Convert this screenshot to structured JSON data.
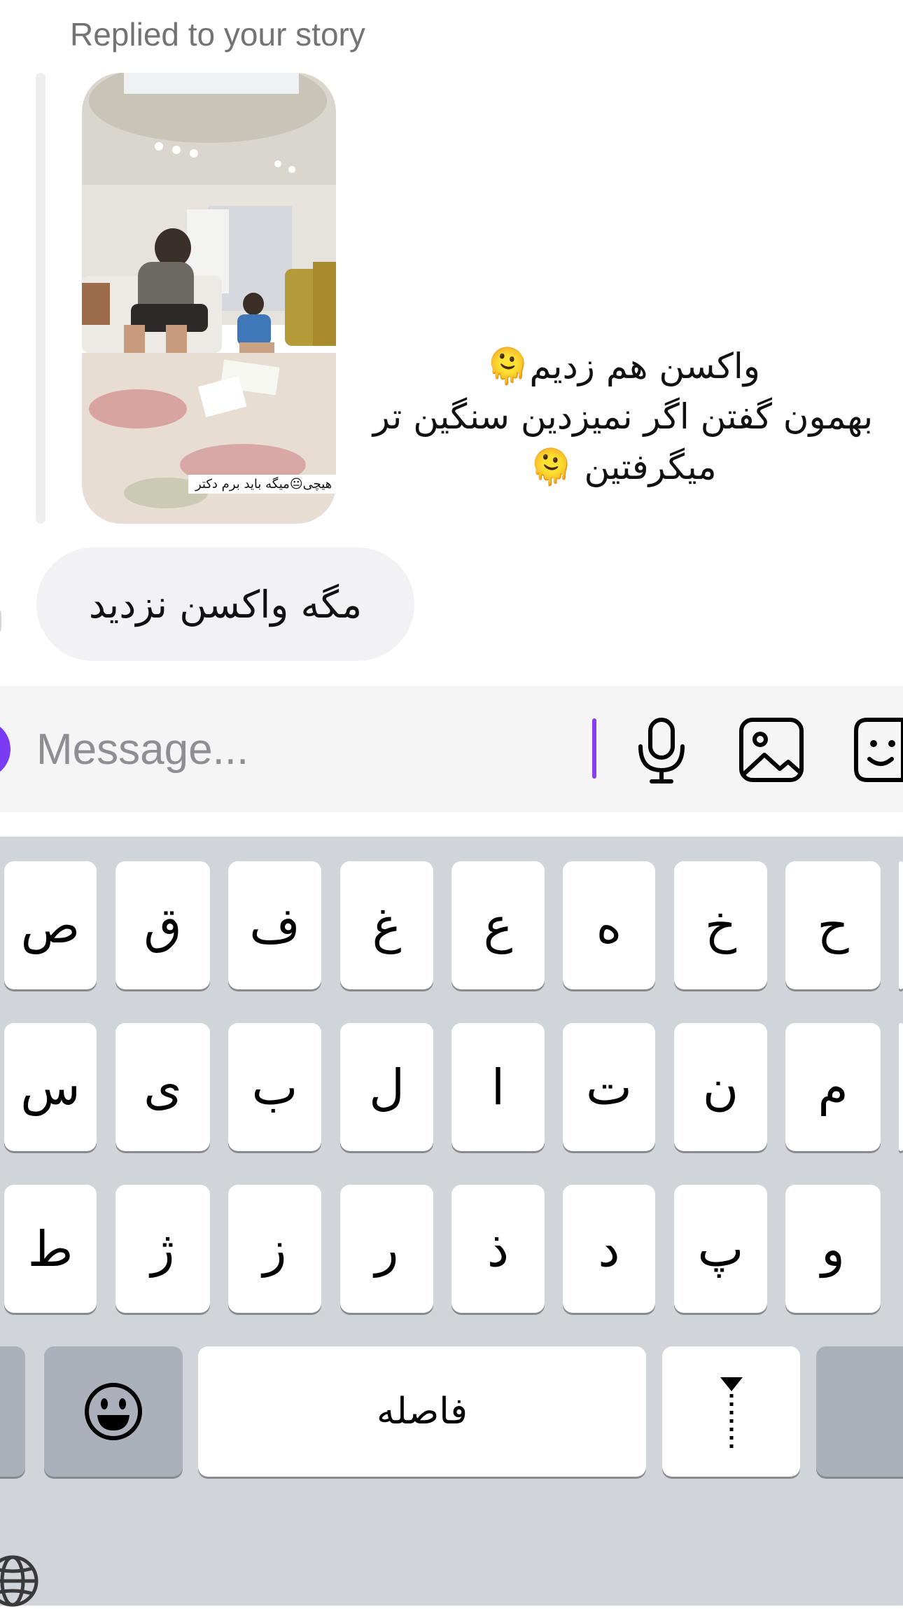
{
  "conversation": {
    "replied_label": "Replied to your story",
    "story_caption": "هیچی😐میگه باید برم دکتر",
    "story_text_lines": [
      "واکسن هم زدیم🫠",
      "بهمون گفتن اگر نمیزدین سنگین تر",
      "میگرفتین 🫠"
    ],
    "reply_message": "مگه واکسن نزدید"
  },
  "composer": {
    "placeholder": "Message...",
    "icons": [
      "microphone-icon",
      "image-icon",
      "sticker-icon"
    ],
    "accent_color": "#7a3cf2"
  },
  "keyboard": {
    "row1": [
      "ص",
      "ق",
      "ف",
      "غ",
      "ع",
      "ه",
      "خ",
      "ح"
    ],
    "row2": [
      "س",
      "ی",
      "ب",
      "ل",
      "ا",
      "ت",
      "ن",
      "م"
    ],
    "row3": [
      "ط",
      "ژ",
      "ز",
      "ر",
      "ذ",
      "د",
      "پ",
      "و"
    ],
    "space_label": "فاصله",
    "icons": [
      "emoji-icon",
      "zwnj-icon",
      "globe-icon"
    ],
    "background_color": "#d1d4d9"
  }
}
